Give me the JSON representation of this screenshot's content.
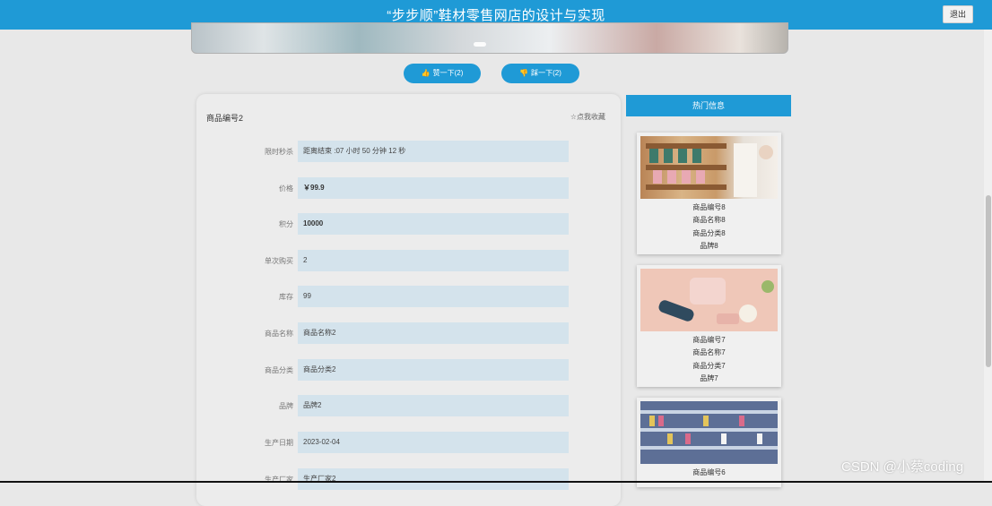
{
  "header": {
    "title": "“步步顺”鞋材零售网店的设计与实现",
    "logout_label": "退出"
  },
  "vote": {
    "like_label": "赞一下(2)",
    "dislike_label": "踩一下(2)"
  },
  "product": {
    "code_title": "商品编号2",
    "favorite_label": "☆点我收藏",
    "fields": [
      {
        "label": "限时秒杀",
        "value": "距离结束 :07 小时 50 分钟 12 秒"
      },
      {
        "label": "价格",
        "value": "￥99.9"
      },
      {
        "label": "积分",
        "value": "10000"
      },
      {
        "label": "单次购买",
        "value": "2"
      },
      {
        "label": "库存",
        "value": "99"
      },
      {
        "label": "商品名称",
        "value": "商品名称2"
      },
      {
        "label": "商品分类",
        "value": "商品分类2"
      },
      {
        "label": "品牌",
        "value": "品牌2"
      },
      {
        "label": "生产日期",
        "value": "2023-02-04"
      },
      {
        "label": "生产厂家",
        "value": "生产厂家2"
      }
    ]
  },
  "hot": {
    "title": "热门信息",
    "items": [
      {
        "code": "商品编号8",
        "name": "商品名称8",
        "category": "商品分类8",
        "brand": "品牌8"
      },
      {
        "code": "商品编号7",
        "name": "商品名称7",
        "category": "商品分类7",
        "brand": "品牌7"
      },
      {
        "code": "商品编号6"
      }
    ]
  },
  "watermark": "CSDN @小蔡coding",
  "colors": {
    "accent": "#1f9ad6",
    "field_bg": "#d4e3ec"
  }
}
